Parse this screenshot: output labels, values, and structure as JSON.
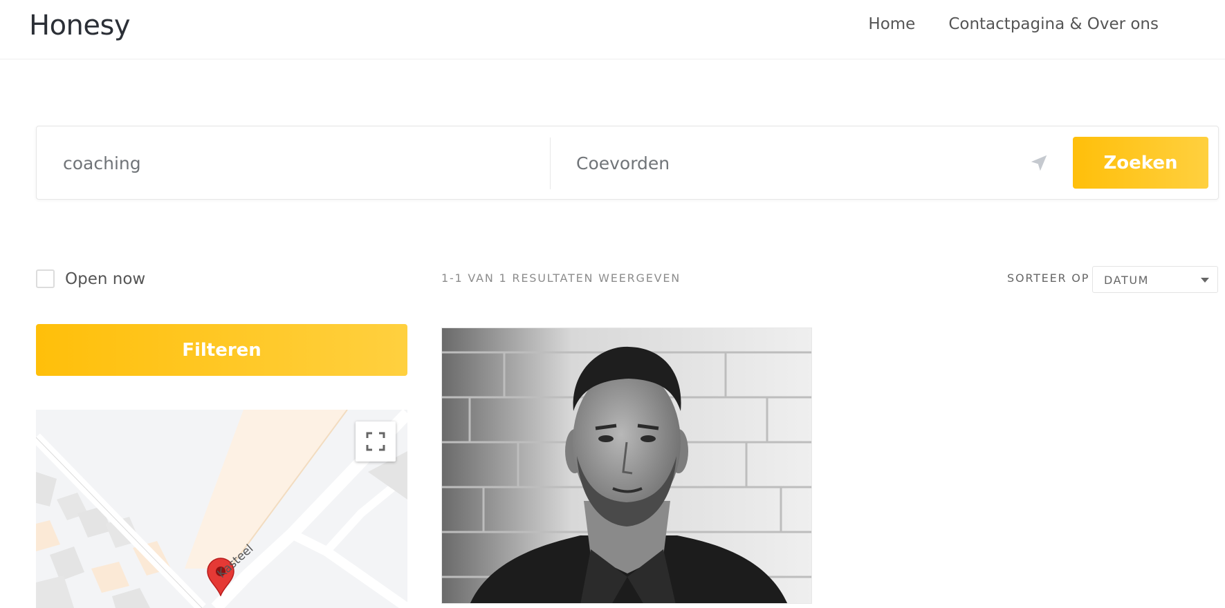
{
  "header": {
    "logo": "Honesy",
    "nav": [
      {
        "label": "Home"
      },
      {
        "label": "Contactpagina & Over ons"
      }
    ]
  },
  "search": {
    "keyword_value": "coaching",
    "location_value": "Coevorden",
    "locate_icon": "location-arrow-icon",
    "submit_label": "Zoeken"
  },
  "filters": {
    "open_now_label": "Open now",
    "open_now_checked": false,
    "results_text": "1-1 VAN 1 RESULTATEN WEERGEVEN",
    "sort_label": "SORTEER OP",
    "sort_value": "DATUM",
    "filter_button_label": "Filteren"
  },
  "map": {
    "street_label": "Kasteel",
    "fullscreen_icon": "fullscreen-icon",
    "marker_icon": "map-marker-icon"
  },
  "listings": [
    {
      "photo": "grayscale portrait of a man in front of a brick wall"
    }
  ],
  "colors": {
    "accent": "#ffbf0a",
    "accent_end": "#ffd03f",
    "marker": "#e53935"
  }
}
